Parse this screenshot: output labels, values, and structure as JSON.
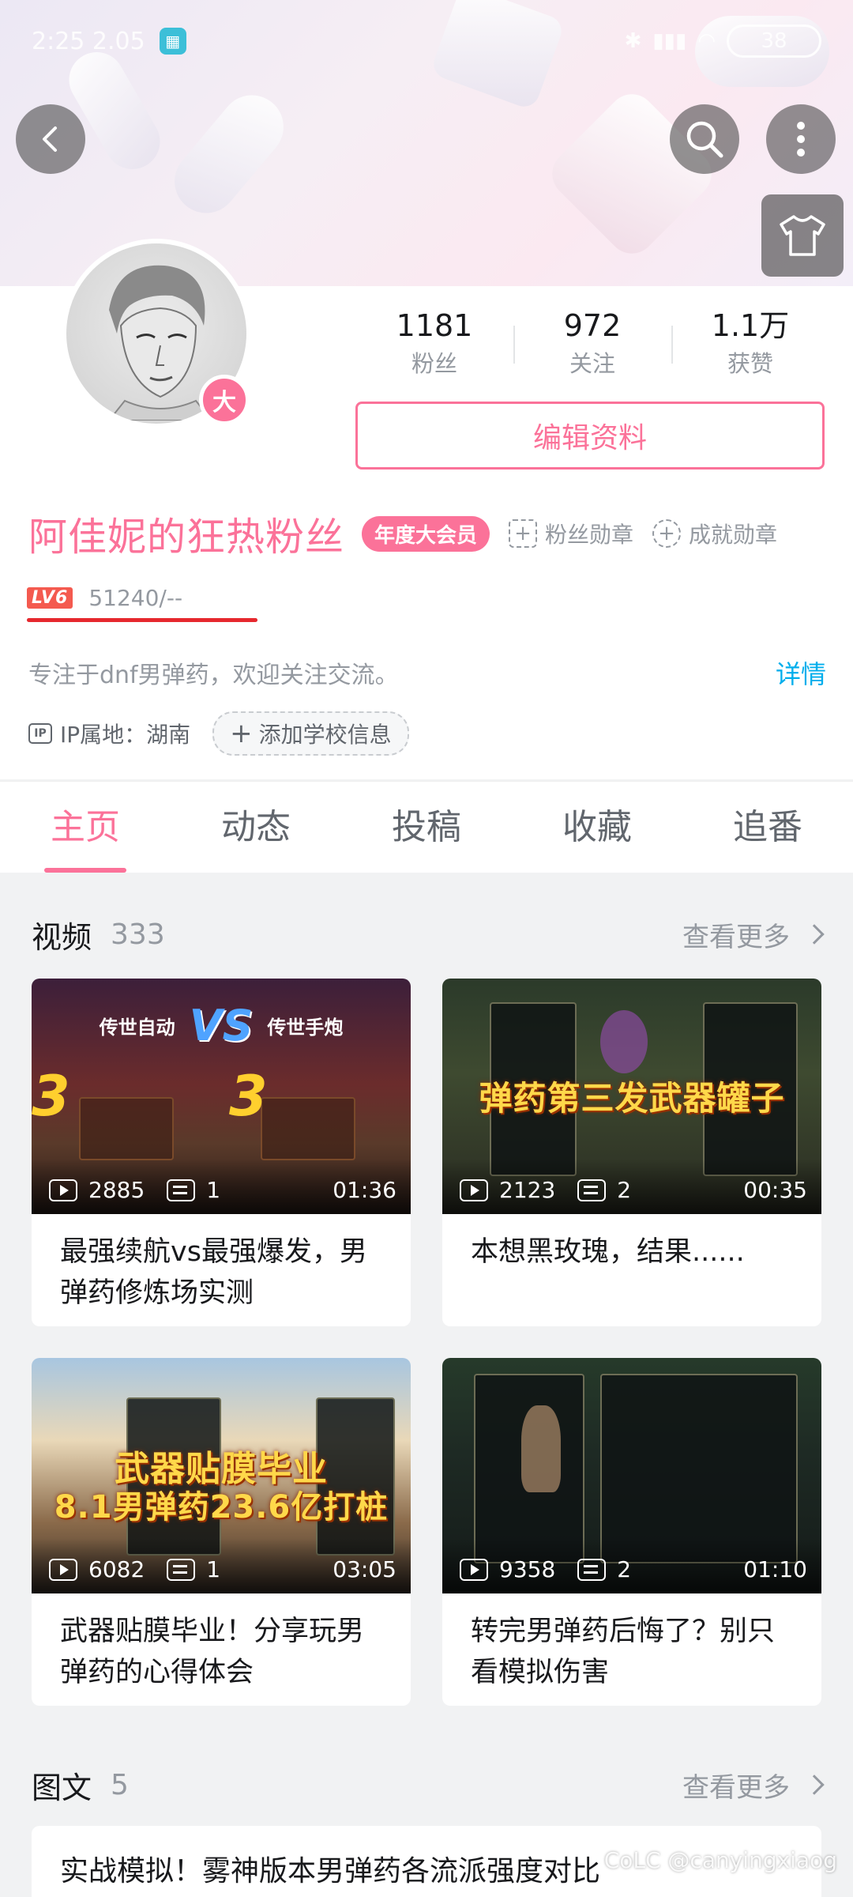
{
  "status": {
    "time": "2:25 2.05",
    "battery": "38"
  },
  "profile": {
    "avatar_badge": "大",
    "stats": [
      {
        "num": "1181",
        "label": "粉丝"
      },
      {
        "num": "972",
        "label": "关注"
      },
      {
        "num": "1.1万",
        "label": "获赞"
      }
    ],
    "edit_label": "编辑资料",
    "name": "阿佳妮的狂热粉丝",
    "vip_label": "年度大会员",
    "medal_fans": "粉丝勋章",
    "medal_achieve": "成就勋章",
    "level": "LV6",
    "exp": "51240/--",
    "signature": "专注于dnf男弹药，欢迎关注交流。",
    "detail_link": "详情",
    "ip_icon": "IP",
    "ip": "IP属地：湖南",
    "add_school": "添加学校信息"
  },
  "tabs": [
    "主页",
    "动态",
    "投稿",
    "收藏",
    "追番"
  ],
  "videos_section": {
    "title": "视频",
    "count": "333",
    "more": "查看更多"
  },
  "videos": [
    {
      "plays": "2885",
      "danmaku": "1",
      "duration": "01:36",
      "title": "最强续航vs最强爆发，男弹药修炼场实测",
      "caption_left": "传世自动",
      "caption_vs": "VS",
      "caption_right": "传世手炮",
      "caption": ""
    },
    {
      "plays": "2123",
      "danmaku": "2",
      "duration": "00:35",
      "title": "本想黑玫瑰，结果......",
      "caption": "弹药第三发武器罐子"
    },
    {
      "plays": "6082",
      "danmaku": "1",
      "duration": "03:05",
      "title": "武器贴膜毕业！分享玩男弹药的心得体会",
      "caption": "武器贴膜毕业",
      "caption2": "8.1男弹药23.6亿打桩"
    },
    {
      "plays": "9358",
      "danmaku": "2",
      "duration": "01:10",
      "title": "转完男弹药后悔了？别只看模拟伤害",
      "caption": ""
    }
  ],
  "articles_section": {
    "title": "图文",
    "count": "5",
    "more": "查看更多"
  },
  "articles": [
    {
      "title": "实战模拟！雾神版本男弹药各流派强度对比"
    }
  ],
  "watermark": "CoLC @canyingxiaog",
  "colors": {
    "accent": "#fb7299",
    "link": "#00aeec",
    "level": "#f45a4f"
  }
}
